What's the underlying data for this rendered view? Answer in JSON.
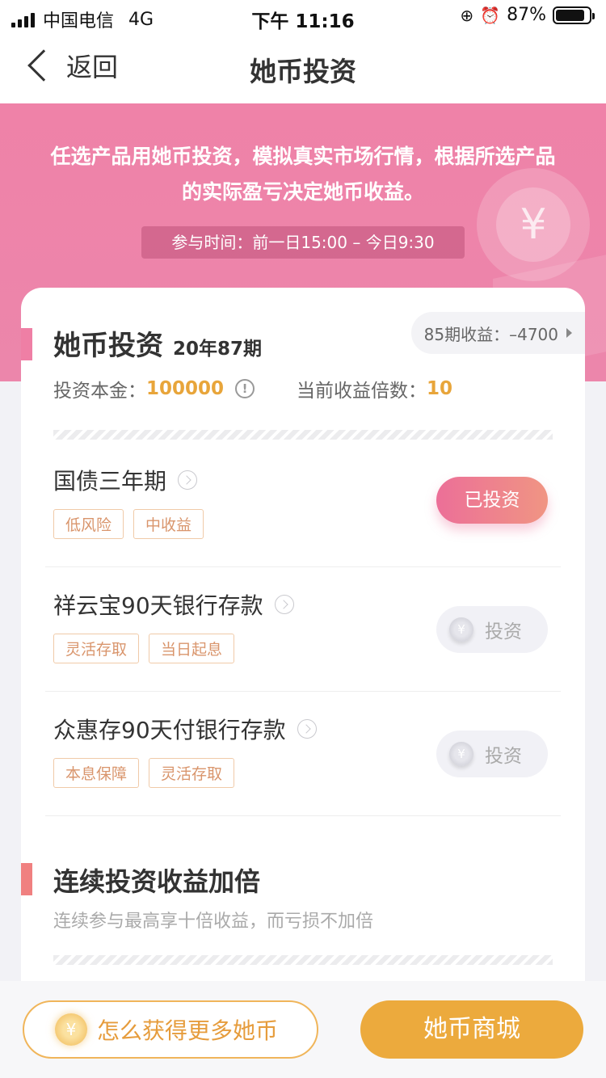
{
  "status_bar": {
    "carrier": "中国电信",
    "network": "4G",
    "time": "下午 11:16",
    "battery": "87%",
    "battery_level": 0.87
  },
  "nav": {
    "back_label": "返回",
    "title": "她币投资"
  },
  "banner": {
    "description": "任选产品用她币投资，模拟真实市场行情，根据所选产品的实际盈亏决定她币收益。",
    "time": "参与时间：前一日15:00 – 今日9:30"
  },
  "investment": {
    "title": "她币投资",
    "period": "20年87期",
    "prev_profit": "85期收益：–4700",
    "capital_label": "投资本金：",
    "capital_value": "100000",
    "multiplier_label": "当前收益倍数：",
    "multiplier_value": "10"
  },
  "products": [
    {
      "name": "国债三年期",
      "tags": [
        "低风险",
        "中收益"
      ],
      "status": "已投资"
    },
    {
      "name": "祥云宝90天银行存款",
      "tags": [
        "灵活存取",
        "当日起息"
      ],
      "status": "投资"
    },
    {
      "name": "众惠存90天付银行存款",
      "tags": [
        "本息保障",
        "灵活存取"
      ],
      "status": "投资"
    }
  ],
  "bonus": {
    "title": "连续投资收益加倍",
    "subtitle": "连续参与最高享十倍收益，而亏损不加倍"
  },
  "bottom": {
    "how_label": "怎么获得更多她币",
    "mall_label": "她币商城"
  },
  "colors": {
    "brand_pink": "#ef82a8",
    "gold": "#e8a53a",
    "mall_button": "#ecaa3d"
  }
}
